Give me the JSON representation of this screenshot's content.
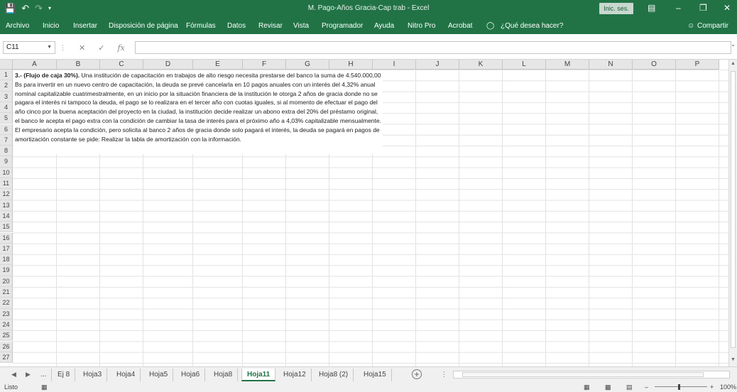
{
  "titlebar": {
    "title": "M. Pago-Años Gracia-Cap trab  -  Excel",
    "signin": "Inic. ses."
  },
  "ribbon": {
    "tabs": [
      "Archivo",
      "Inicio",
      "Insertar",
      "Disposición de página",
      "Fórmulas",
      "Datos",
      "Revisar",
      "Vista",
      "Programador",
      "Ayuda",
      "Nitro Pro",
      "Acrobat"
    ],
    "tell_me": "¿Qué desea hacer?",
    "share": "Compartir"
  },
  "formula_bar": {
    "name_box": "C11",
    "fx": "fx",
    "formula": ""
  },
  "columns": [
    "A",
    "B",
    "C",
    "D",
    "E",
    "F",
    "G",
    "H",
    "I",
    "J",
    "K",
    "L",
    "M",
    "N",
    "O",
    "P"
  ],
  "rows": [
    "1",
    "2",
    "3",
    "4",
    "5",
    "6",
    "7",
    "8",
    "9",
    "10",
    "11",
    "12",
    "13",
    "14",
    "15",
    "16",
    "17",
    "18",
    "19",
    "20",
    "21",
    "22",
    "23",
    "24",
    "25",
    "26",
    "27"
  ],
  "textbox": {
    "bold_lead": "3.- (Flujo de caja 30%).",
    "body": " Una institución de capacitación en trabajos de alto riesgo necesita prestarse del banco la suma de 4.540.000,00 Bs para invertir en un nuevo centro de capacitación, la deuda se prevé cancelarla en 10 pagos anuales con un interés del 4,32% anual nominal capitalizable cuatrimestralmente, en un inicio por la situación financiera de la institución le otorga 2 años de gracia donde no se pagara el interés ni tampoco la deuda, el pago se lo realizara en el tercer año con cuotas iguales, si al momento de efectuar el pago del año cinco por la buena aceptación del proyecto en la ciudad, la institución decide realizar un abono extra del 20% del préstamo original, el banco le acepta el pago extra con la condición de cambiar la tasa de interés para el próximo año a 4,03% capitalizable mensualmente. El empresario acepta la condición, pero solicita al banco 2 años de gracia donde solo pagará el interés, la deuda se pagará en pagos de amortización constante se pide: Realizar la tabla de amortización con la información."
  },
  "sheets": {
    "nav_more": "...",
    "tabs": [
      "Ej 8",
      "Hoja3",
      "Hoja4",
      "Hoja5",
      "Hoja6",
      "Hoja8",
      "Hoja11",
      "Hoja12",
      "Hoja8 (2)",
      "Hoja15"
    ],
    "active": "Hoja11"
  },
  "status": {
    "ready": "Listo",
    "zoom": "100%"
  },
  "colors": {
    "brand": "#217346"
  }
}
